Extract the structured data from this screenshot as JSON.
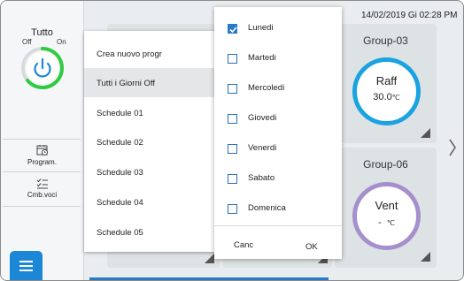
{
  "header": {
    "datetime": "14/02/2019 Gi 02:28 PM"
  },
  "sidebar": {
    "power": {
      "title": "Tutto",
      "off_label": "Off",
      "on_label": "On"
    },
    "items": [
      {
        "label": "Program.",
        "icon": "calendar-clock-icon"
      },
      {
        "label": "Cmb.voci",
        "icon": "checklist-icon"
      }
    ],
    "menu_icon": "hamburger-menu-icon"
  },
  "groups": [
    {
      "title": "Group-03",
      "mode": "Raff",
      "temp": "30.0",
      "unit": "℃",
      "color": "#1aa3e0"
    },
    {
      "title": "Group-06",
      "mode": "Vent",
      "temp": "-",
      "unit": "℃",
      "color": "#a58fcc"
    }
  ],
  "schedule_menu": {
    "items": [
      "Crea nuovo progr",
      "Tutti i Giorni Off",
      "Schedule 01",
      "Schedule 02",
      "Schedule 03",
      "Schedule 04",
      "Schedule 05"
    ],
    "selected_index": 1
  },
  "day_menu": {
    "days": [
      {
        "label": "Lunedi",
        "checked": true
      },
      {
        "label": "Martedi",
        "checked": false
      },
      {
        "label": "Mercoledi",
        "checked": false
      },
      {
        "label": "Giovedi",
        "checked": false
      },
      {
        "label": "Venerdi",
        "checked": false
      },
      {
        "label": "Sabato",
        "checked": false
      },
      {
        "label": "Domenica",
        "checked": false
      }
    ],
    "cancel_label": "Canc",
    "ok_label": "OK"
  },
  "colors": {
    "accent": "#1b87d6",
    "power_on": "#2ecc40",
    "cool": "#1aa3e0",
    "fan": "#a58fcc"
  }
}
